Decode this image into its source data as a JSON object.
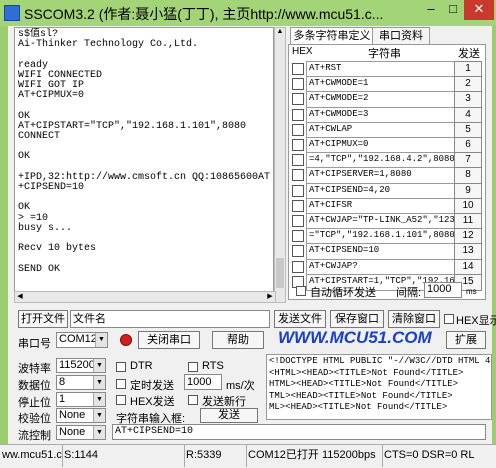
{
  "window": {
    "title": "SSCOM3.2 (作者:聂小猛(丁丁), 主页http://www.mcu51.c...",
    "minimize": "–",
    "maximize": "□",
    "close": "✕"
  },
  "receive": {
    "text": "s$值sl?\nAi-Thinker Technology Co.,Ltd.\n\nready\nWIFI CONNECTED\nWIFI GOT IP\nAT+CIPMUX=0\n\nOK\nAT+CIPSTART=\"TCP\",\"192.168.1.101\",8080\nCONNECT\n\nOK\n\n+IPD,32:http://www.cmsoft.cn QQ:10865600AT\n+CIPSEND=10\n\nOK\n> =10\nbusy s...\n\nRecv 10 bytes\n\nSEND OK"
  },
  "tabs": [
    "多条字符串定义",
    "串口资料"
  ],
  "multi": {
    "col_hex": "HEX",
    "col_string": "字符串",
    "col_send": "发送",
    "rows": [
      {
        "text": "AT+RST",
        "num": "1"
      },
      {
        "text": "AT+CWMODE=1",
        "num": "2"
      },
      {
        "text": "AT+CWMODE=2",
        "num": "3"
      },
      {
        "text": "AT+CWMODE=3",
        "num": "4"
      },
      {
        "text": "AT+CWLAP",
        "num": "5"
      },
      {
        "text": "AT+CIPMUX=0",
        "num": "6"
      },
      {
        "text": "=4,\"TCP\",\"192.168.4.2\",8080",
        "num": "7"
      },
      {
        "text": "AT+CIPSERVER=1,8080",
        "num": "8"
      },
      {
        "text": "AT+CIPSEND=4,20",
        "num": "9"
      },
      {
        "text": "AT+CIFSR",
        "num": "10"
      },
      {
        "text": "AT+CWJAP=\"TP-LINK_A52\",\"1234",
        "num": "11"
      },
      {
        "text": "=\"TCP\",\"192.168.1.101\",8080",
        "num": "12"
      },
      {
        "text": "AT+CIPSEND=10",
        "num": "13"
      },
      {
        "text": "AT+CWJAP?",
        "num": "14"
      },
      {
        "text": "AT+CIPSTART=1,\"TCP\",\"192.16",
        "num": "15"
      }
    ],
    "auto_loop": "自动循环发送",
    "interval_label": "间隔:",
    "interval_value": "1000",
    "interval_unit": "ms"
  },
  "toolbar1": {
    "open_file": "打开文件",
    "file_name": "文件名",
    "send_file": "发送文件",
    "save_window": "保存窗口",
    "clear_window": "清除窗口",
    "hex_display": "HEX显示"
  },
  "toolbar2": {
    "port_label": "串口号",
    "port_value": "COM12",
    "close_port": "关闭串口",
    "help": "帮助",
    "logo": "WWW.MCU51.COM",
    "expand": "扩展"
  },
  "settings": {
    "baud_label": "波特率",
    "baud_value": "115200",
    "databits_label": "数据位",
    "databits_value": "8",
    "stopbits_label": "停止位",
    "stopbits_value": "1",
    "parity_label": "校验位",
    "parity_value": "None",
    "flow_label": "流控制",
    "flow_value": "None",
    "dtr": "DTR",
    "rts": "RTS",
    "timed_send": "定时发送",
    "period_value": "1000",
    "period_unit": "ms/次",
    "hex_send": "HEX发送",
    "send_newline": "发送新行",
    "input_label": "字符串输入框:",
    "send_button": "发送",
    "input_value": "AT+CIPSEND=10"
  },
  "info": {
    "text": "<!DOCTYPE HTML PUBLIC \"-//W3C//DTD HTML 4.\n<HTML><HEAD><TITLE>Not Found</TITLE>\nHTML><HEAD><TITLE>Not Found</TITLE>\nTML><HEAD><TITLE>Not Found</TITLE>\nML><HEAD><TITLE>Not Found</TITLE>"
  },
  "status": {
    "site": "ww.mcu51.cor",
    "s": "S:1144",
    "r": "R:5339",
    "port": "COM12已打开  115200bps",
    "signals": "CTS=0 DSR=0 RL"
  }
}
